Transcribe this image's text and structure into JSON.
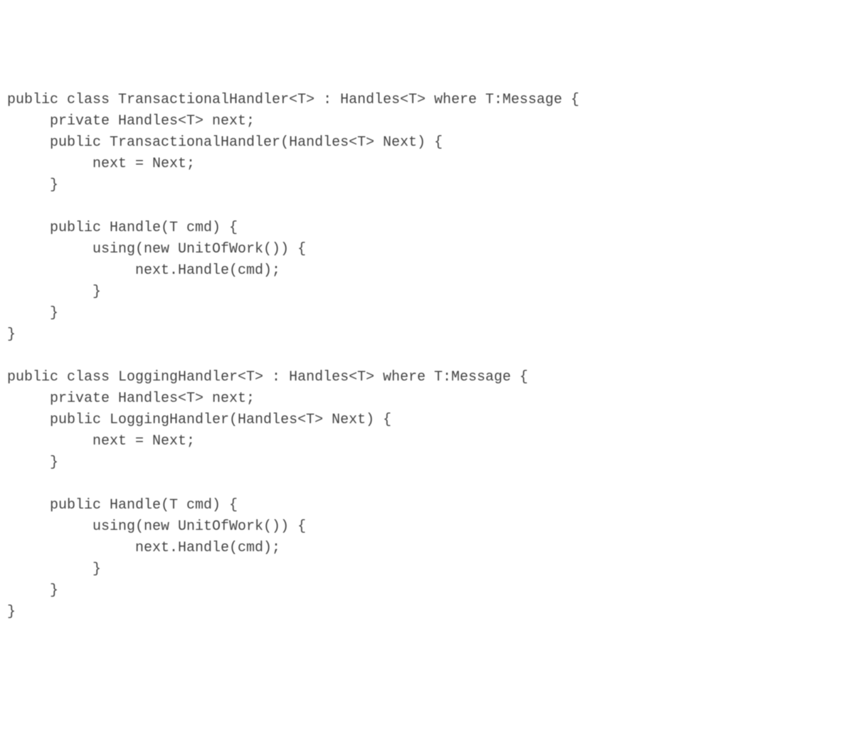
{
  "code": {
    "lines": [
      "public class TransactionalHandler<T> : Handles<T> where T:Message {",
      "     private Handles<T> next;",
      "     public TransactionalHandler(Handles<T> Next) {",
      "          next = Next;",
      "     }",
      "",
      "     public Handle(T cmd) {",
      "          using(new UnitOfWork()) {",
      "               next.Handle(cmd);",
      "          }",
      "     }",
      "}",
      "",
      "public class LoggingHandler<T> : Handles<T> where T:Message {",
      "     private Handles<T> next;",
      "     public LoggingHandler(Handles<T> Next) {",
      "          next = Next;",
      "     }",
      "",
      "     public Handle(T cmd) {",
      "          using(new UnitOfWork()) {",
      "               next.Handle(cmd);",
      "          }",
      "     }",
      "}"
    ]
  }
}
